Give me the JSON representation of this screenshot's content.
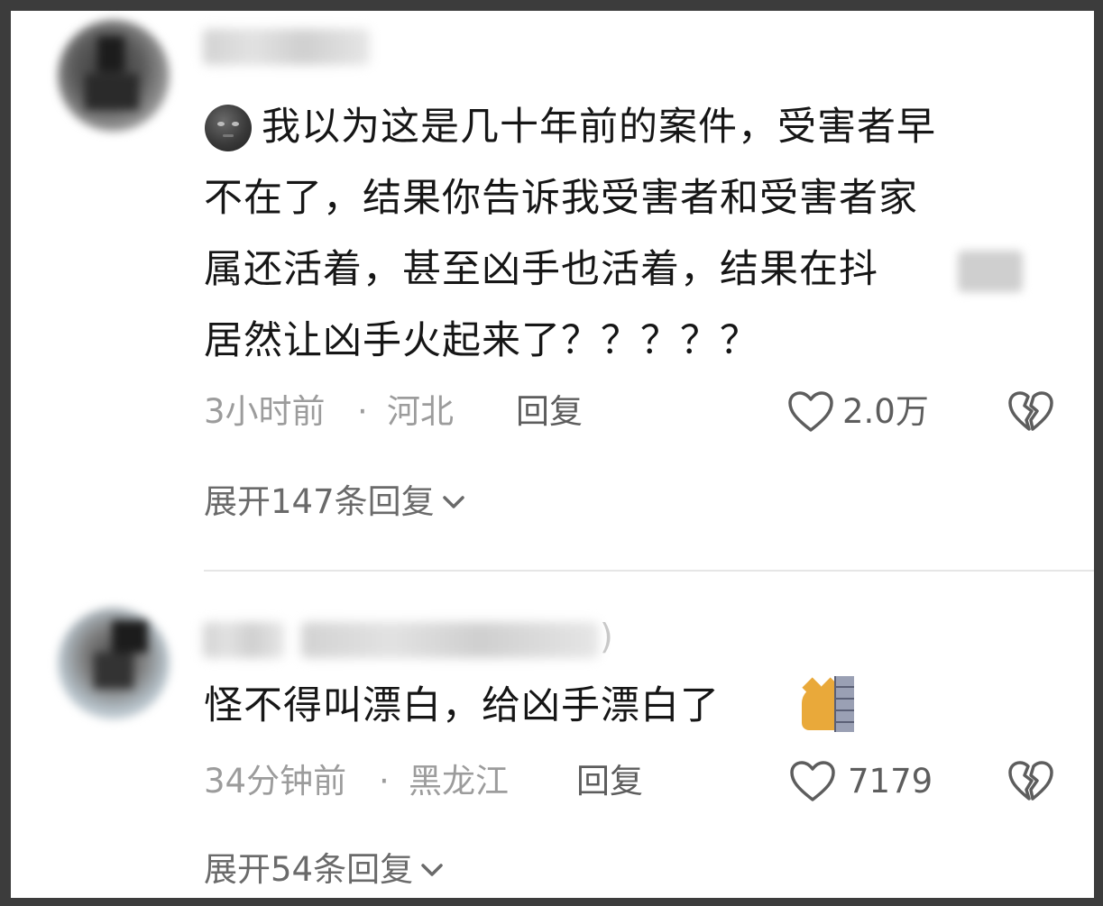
{
  "comments": [
    {
      "text_lines": [
        "我以为这是几十年前的案件，受害者早",
        "不在了，结果你告诉我受害者和受害者家",
        "属还活着，甚至凶手也活着，结果在抖",
        "居然让凶手火起来了？？？？？"
      ],
      "leading_emoji": "new-moon-face-emoji",
      "time": "3小时前",
      "separator": "·",
      "location": "河北",
      "reply_label": "回复",
      "likes": "2.0万",
      "expand_label": "展开147条回复"
    },
    {
      "username_suffix": ")",
      "text": "怪不得叫漂白，给凶手漂白了",
      "trailing_emoji": "cat-peeking-behind-wall-emoji",
      "time": "34分钟前",
      "separator": "·",
      "location": "黑龙江",
      "reply_label": "回复",
      "likes": "7179",
      "expand_label": "展开54条回复"
    }
  ],
  "colors": {
    "text_primary": "#161616",
    "text_meta": "#9c9c9c",
    "text_action": "#5d5d5d",
    "frame_border": "#3c3c3c"
  }
}
